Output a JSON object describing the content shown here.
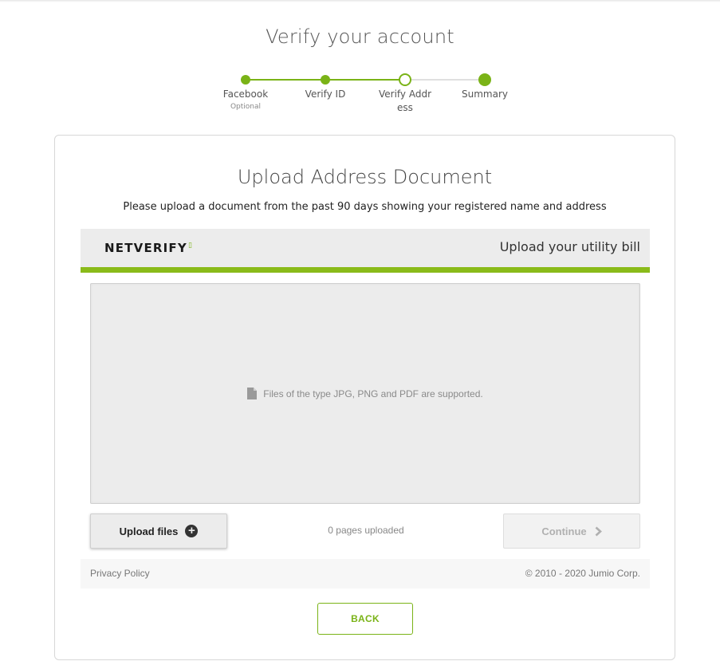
{
  "page": {
    "title": "Verify your account"
  },
  "stepper": {
    "steps": [
      {
        "label": "Facebook",
        "sublabel": "Optional",
        "state": "completed"
      },
      {
        "label": "Verify ID",
        "sublabel": "",
        "state": "completed"
      },
      {
        "label": "Verify Addr\ness",
        "sublabel": "",
        "state": "current"
      },
      {
        "label": "Summary",
        "sublabel": "",
        "state": "upcoming"
      }
    ]
  },
  "card": {
    "title": "Upload Address Document",
    "subtitle": "Please upload a document from the past 90 days showing your registered name and address"
  },
  "netverify": {
    "logo_text": "NETVERIFY",
    "header_title": "Upload your utility bill",
    "dropzone_text": "Files of the type JPG, PNG and PDF are supported.",
    "upload_label": "Upload files",
    "pages_uploaded": "0 pages uploaded",
    "continue_label": "Continue",
    "privacy_label": "Privacy Policy",
    "copyright": "© 2010 - 2020 Jumio Corp."
  },
  "back_label": "BACK",
  "colors": {
    "accent": "#7ab317",
    "bar": "#8abb1a",
    "track": "#e0e0e0"
  },
  "icons": [
    "file-icon",
    "plus-circle-icon",
    "chevron-right-icon"
  ]
}
